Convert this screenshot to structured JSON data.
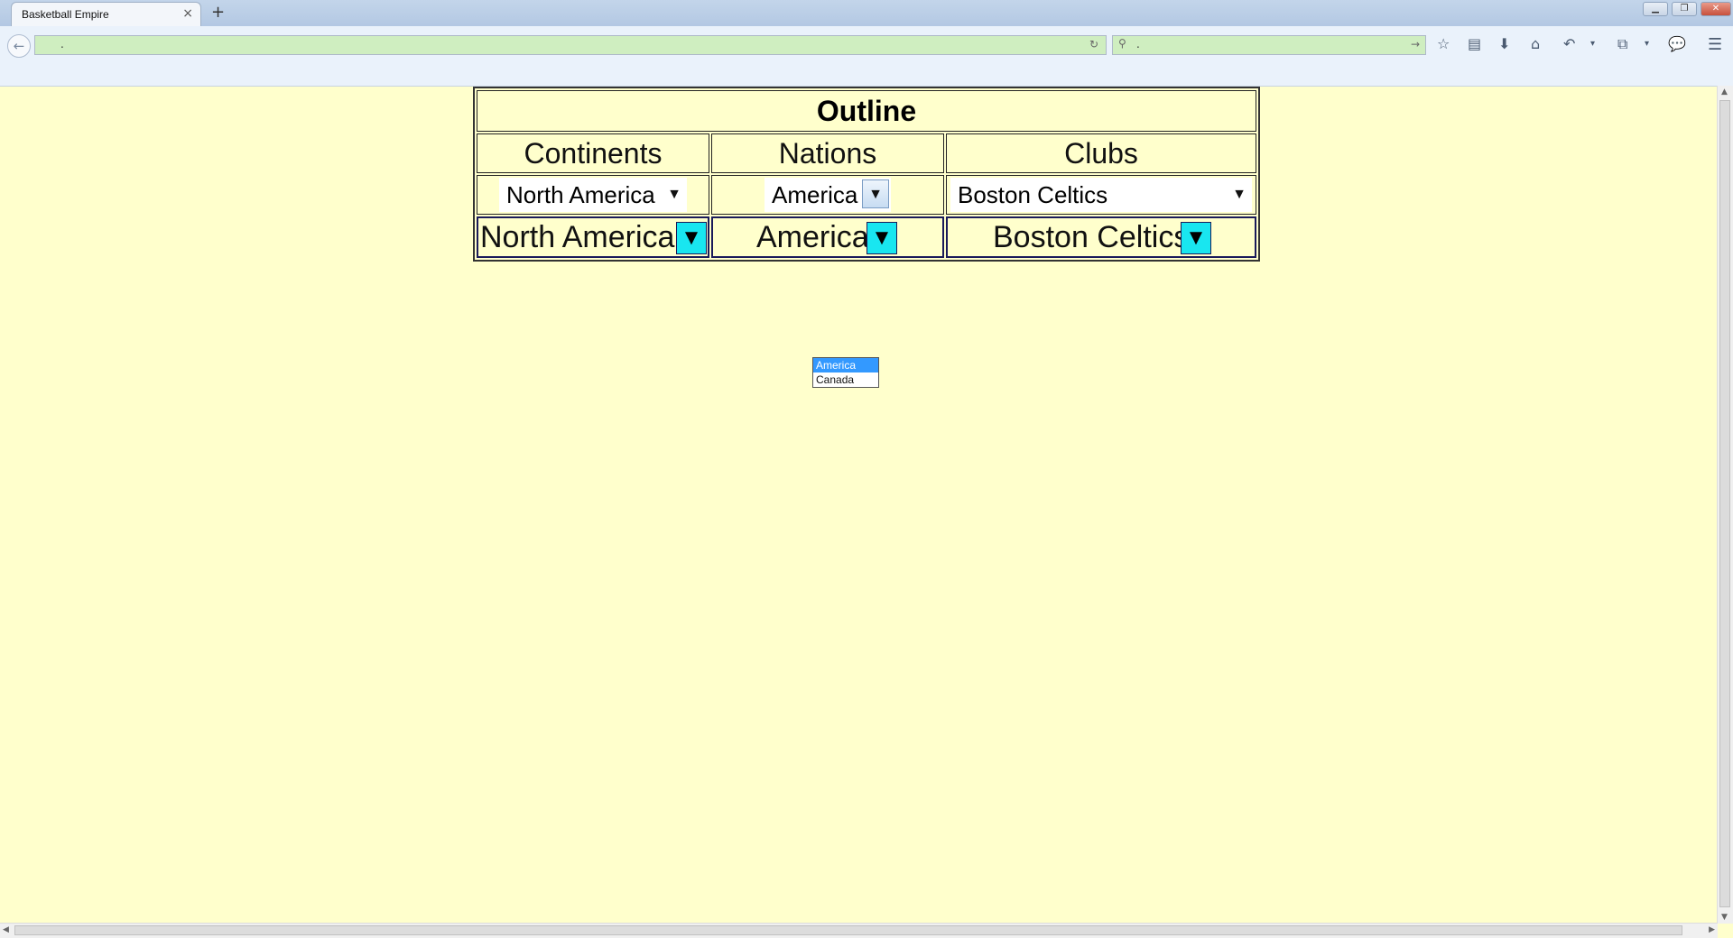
{
  "browser": {
    "tab_title": "Basketball Empire",
    "tab_close": "×",
    "new_tab": "+",
    "url": ".",
    "search_text": "."
  },
  "page": {
    "title": "Outline",
    "columns": [
      "Continents",
      "Nations",
      "Clubs"
    ],
    "selects": {
      "continent": "North America",
      "nation": "America",
      "club": "Boston Celtics"
    },
    "custom_selects": {
      "continent": "North America",
      "nation": "America",
      "club": "Boston Celtics"
    },
    "nation_dropdown": {
      "options": [
        "America",
        "Canada"
      ],
      "highlighted": "America"
    }
  },
  "colors": {
    "page_background": "#ffffcc",
    "custom_button": "#19e6f0",
    "dropdown_highlight": "#3399ff"
  }
}
